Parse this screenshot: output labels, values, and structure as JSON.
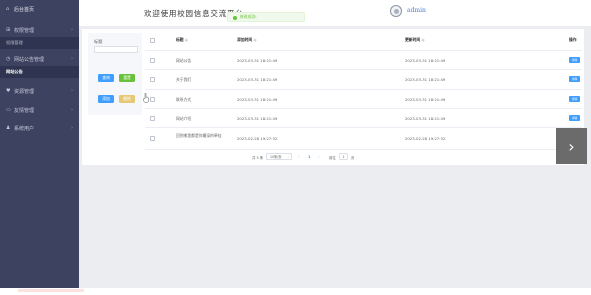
{
  "sidebar": {
    "home": {
      "icon": "home-icon",
      "label": "后台首页"
    },
    "items": [
      {
        "icon": "grid-icon",
        "label": "权限管理",
        "chevron": "chevron-icon"
      },
      {
        "icon": "",
        "label": "权限管理",
        "sub": true
      },
      {
        "icon": "clock-icon",
        "label": "网站公告管理",
        "chevron": "chevron-icon"
      },
      {
        "icon": "",
        "label": "网站公告",
        "sub": true,
        "active": true
      },
      {
        "icon": "heart-icon",
        "label": "资源管理",
        "chevron": "chevron-icon"
      },
      {
        "icon": "folder-icon",
        "label": "友情管理",
        "chevron": "chevron-icon"
      },
      {
        "icon": "user-icon",
        "label": "系统用户",
        "chevron": "chevron-icon"
      }
    ]
  },
  "header": {
    "site_title": "欢迎使用校园信息交流平台",
    "toast": "修改成功!",
    "username": "admin"
  },
  "search": {
    "label": "标题",
    "query_label": "查询",
    "reset_label": "重置",
    "add_label": "添加",
    "delete_label": "删除"
  },
  "table": {
    "columns": [
      "",
      "标题 ◇",
      "添加时间 ◇",
      "更新时间 ◇",
      "操作"
    ],
    "rows": [
      {
        "title": "网站公告",
        "created": "2023-03-31 18:21:49",
        "updated": "2023-03-31 18:21:49",
        "op": "详情"
      },
      {
        "title": "关于我们",
        "created": "2023-03-31 18:21:49",
        "updated": "2023-03-31 18:21:49",
        "op": "详情"
      },
      {
        "title": "联系方式",
        "created": "2023-03-31 18:21:49",
        "updated": "2023-03-31 18:21:49",
        "op": "详情"
      },
      {
        "title": "网站介绍",
        "created": "2023-03-31 18:21:49",
        "updated": "2023-03-31 18:21:49",
        "op": "详情"
      },
      {
        "title": "回到哪里都是你最深的牵挂",
        "created": "2023-02-28 19:27:32",
        "updated": "2023-02-28 19:27:32",
        "op": "详情"
      }
    ]
  },
  "pagination": {
    "total": "共 5 条",
    "page_size": "10条/页",
    "prev": "‹",
    "current": "1",
    "next": "›",
    "goto": "前往",
    "jump_value": "1",
    "page_suffix": "页"
  },
  "overlay": {
    "next_arrow": "›"
  }
}
